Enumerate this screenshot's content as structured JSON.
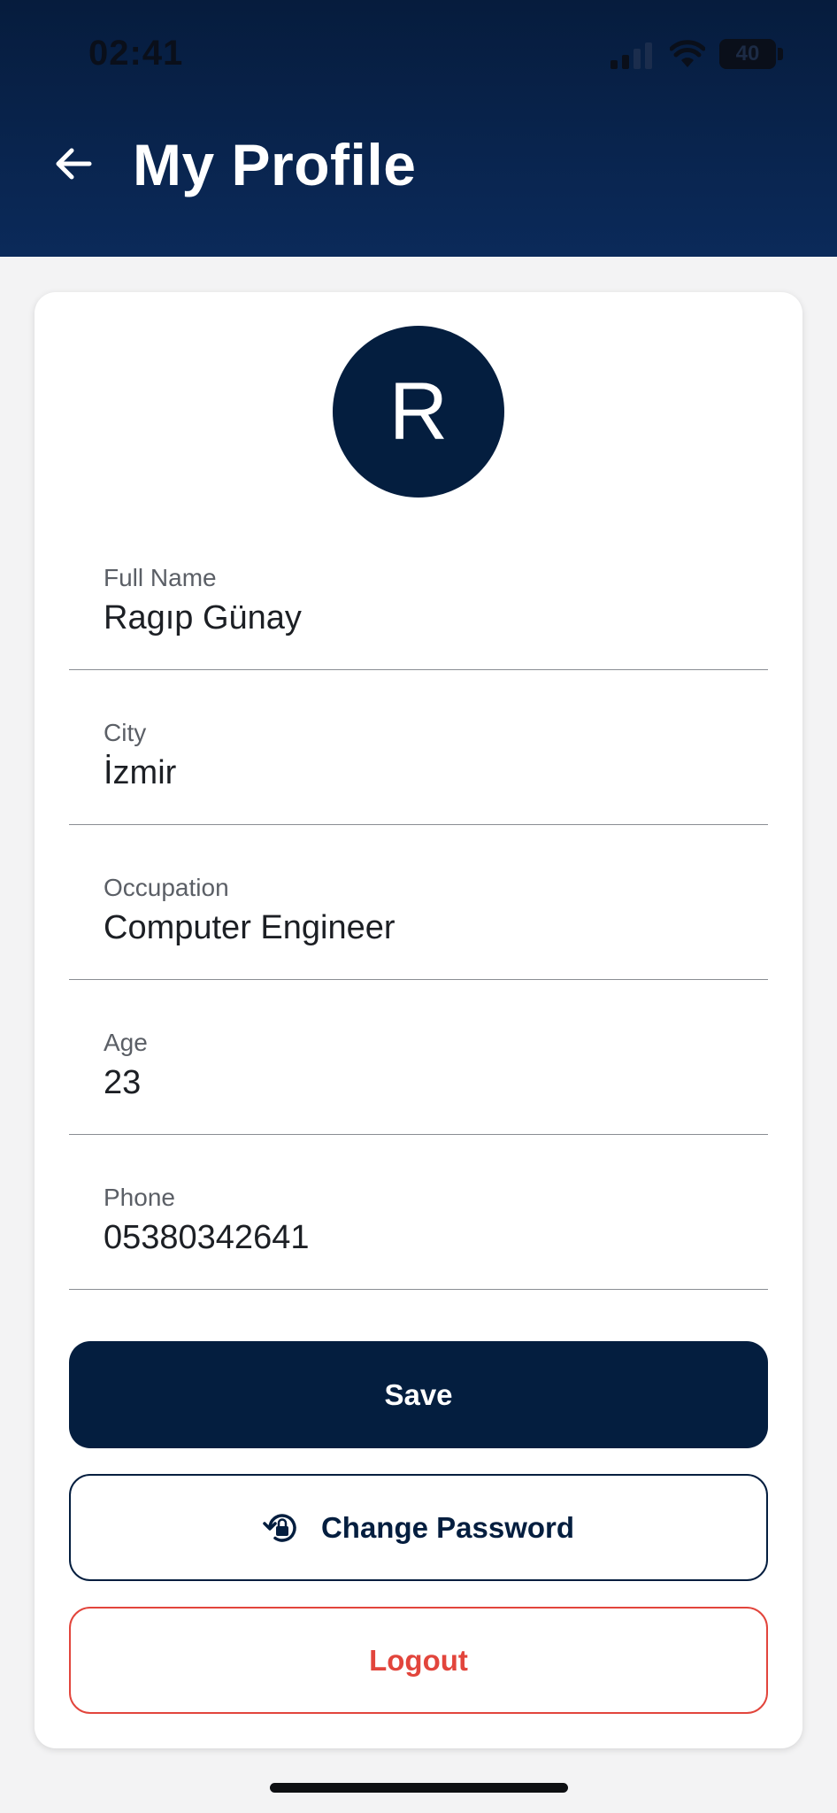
{
  "status_bar": {
    "time": "02:41",
    "battery": "40"
  },
  "header": {
    "title": "My Profile",
    "back_icon": "arrow-left-icon",
    "background_color": "#061c3d"
  },
  "profile": {
    "avatar_initial": "R",
    "avatar_color": "#041e3f"
  },
  "fields": [
    {
      "label": "Full Name",
      "value": "Ragıp Günay"
    },
    {
      "label": "City",
      "value": "İzmir"
    },
    {
      "label": "Occupation",
      "value": "Computer Engineer"
    },
    {
      "label": "Age",
      "value": "23"
    },
    {
      "label": "Phone",
      "value": "05380342641"
    }
  ],
  "actions": {
    "save_label": "Save",
    "change_password_label": "Change Password",
    "change_password_icon": "lock-reset-icon",
    "logout_label": "Logout",
    "primary_color": "#041e3f",
    "danger_color": "#e2453c"
  }
}
